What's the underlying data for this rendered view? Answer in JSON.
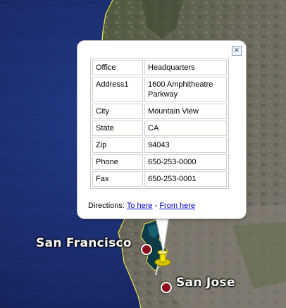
{
  "popup": {
    "close_icon": "×",
    "rows": [
      {
        "key": "Office",
        "value": "Headquarters"
      },
      {
        "key": "Address1",
        "value": "1600 Amphitheatre Parkway"
      },
      {
        "key": "City",
        "value": "Mountain View"
      },
      {
        "key": "State",
        "value": "CA"
      },
      {
        "key": "Zip",
        "value": "94043"
      },
      {
        "key": "Phone",
        "value": "650-253-0000"
      },
      {
        "key": "Fax",
        "value": "650-253-0001"
      }
    ],
    "directions_label": "Directions:",
    "to_here": "To here",
    "separator": "-",
    "from_here": "From here"
  },
  "places": {
    "san_francisco": "San Francisco",
    "san_jose": "San Jose"
  },
  "colors": {
    "ocean": "#1a2a6b",
    "coastline": "#e8e84a",
    "land": "#6e6a63",
    "place_dot": "#8b0f1a",
    "pin": "#f2e600"
  },
  "icons": {
    "pin": "pushpin-icon",
    "place_marker": "place-dot-icon"
  }
}
